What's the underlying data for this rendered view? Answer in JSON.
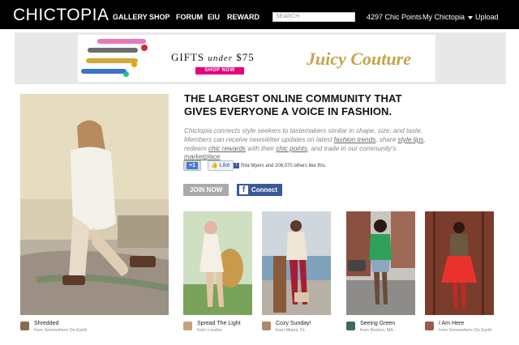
{
  "nav": {
    "logo": "CHICTOPIA",
    "items": [
      "GALLERY",
      "SHOP",
      "FORUM",
      "EIU",
      "REWARD"
    ],
    "search_placeholder": "SEARCH",
    "points": "4297 Chic Points",
    "my_chictopia": "My Chictopia",
    "upload": "Upload"
  },
  "ad": {
    "gifts_text": "GIFTS",
    "under_text": "under",
    "price_text": "$75",
    "shop_button": "SHOP NOW",
    "brand": "Juicy Couture"
  },
  "main": {
    "headline": "THE LARGEST ONLINE COMMUNITY THAT GIVES EVERYONE A VOICE IN FASHION.",
    "blurb_parts": [
      "Chictopia connects style seekers to tastemakers similar in shape, size, and taste. Members can receive newsletter updates on latest ",
      "fashion trends",
      ", share ",
      "style tips",
      ", redeem ",
      "chic rewards",
      " with their ",
      "chic points",
      ", and trade in our community's ",
      "marketplace"
    ],
    "plus_one": "+1",
    "like": "Like",
    "likes_text": "Rita Myers and 206,070 others like this.",
    "join_button": "JOIN NOW",
    "connect_button": "Connect"
  },
  "hero_post": {
    "name": "Shredded",
    "from": "from Somewhere On Earth"
  },
  "posts": [
    {
      "name": "Spread The Light",
      "from": "from London"
    },
    {
      "name": "Cozy Sunday!",
      "from": "from Miami, FL"
    },
    {
      "name": "Seeing Green",
      "from": "from Boston, MA"
    },
    {
      "name": "I Am Here",
      "from": "from Somewhere On Earth"
    }
  ],
  "colors": {
    "nav_bg": "#000000",
    "facebook_blue": "#3b5998",
    "ad_pink": "#e6007e",
    "brand_gold": "#c8a24a"
  }
}
